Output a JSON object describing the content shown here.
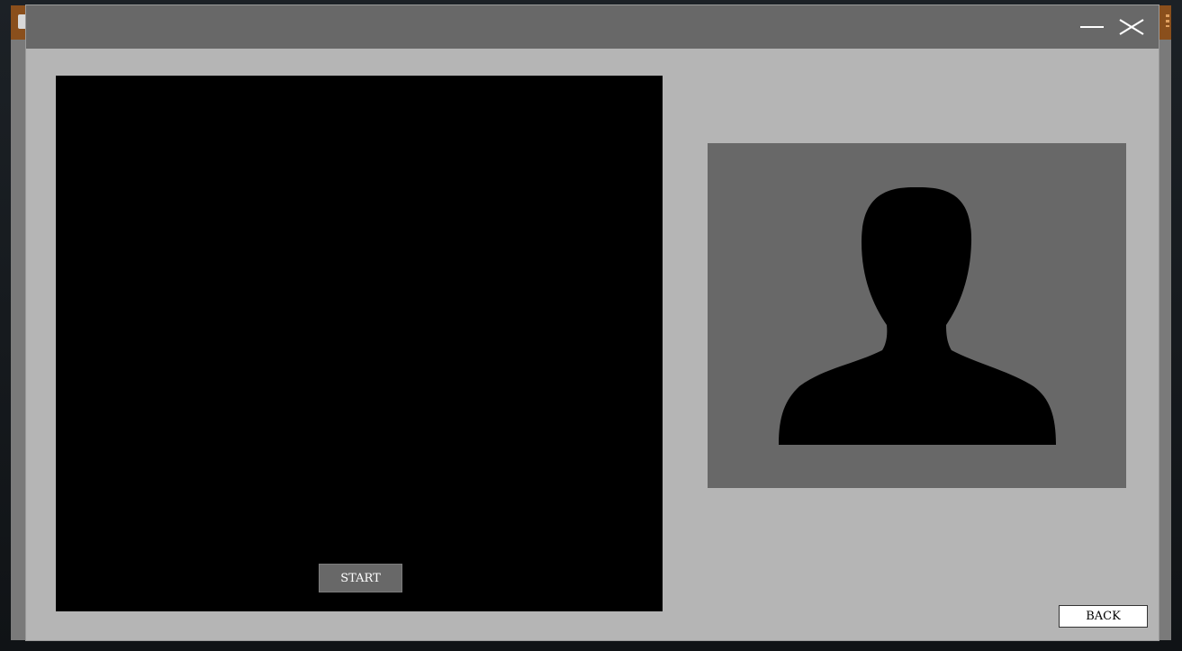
{
  "window": {
    "minimize_icon": "minimize-icon",
    "close_icon": "close-icon"
  },
  "video": {
    "start_label": "START"
  },
  "photo": {
    "placeholder_icon": "person-silhouette-icon"
  },
  "footer": {
    "back_label": "BACK"
  },
  "colors": {
    "titlebar": "#686868",
    "window_bg": "#b5b5b5",
    "video_bg": "#000000",
    "photo_bg": "#686868",
    "parent_titlebar": "#8a4f1c"
  }
}
